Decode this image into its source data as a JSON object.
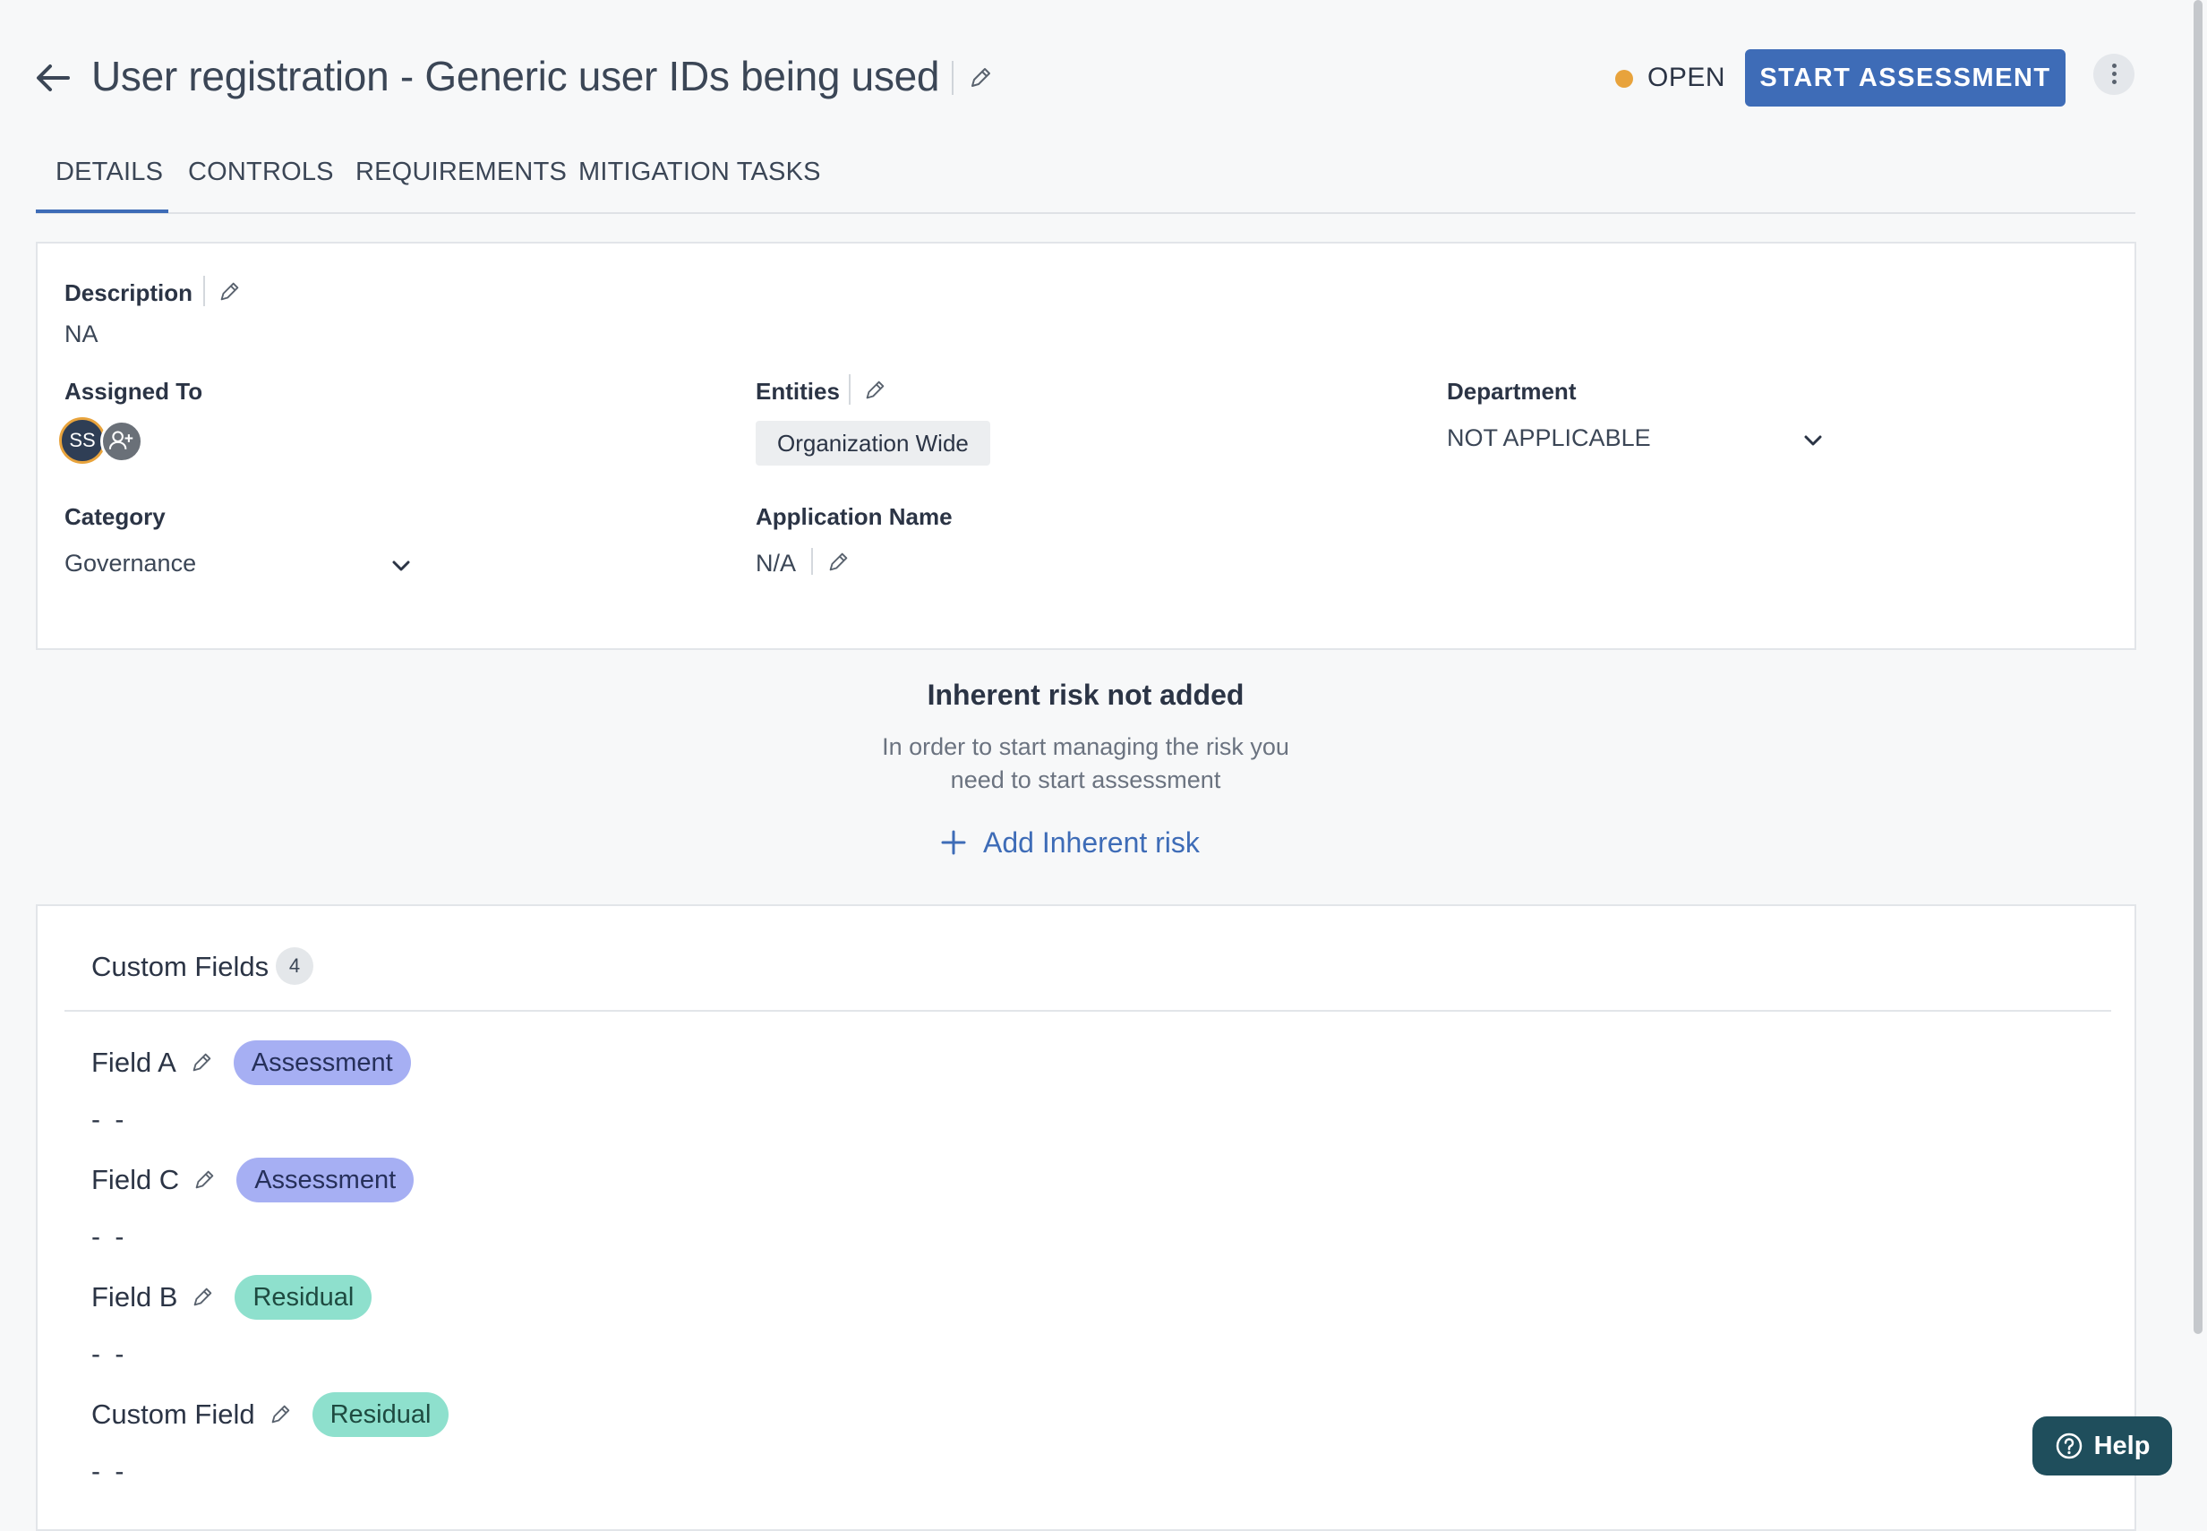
{
  "header": {
    "title": "User registration - Generic user IDs being used",
    "status": "OPEN",
    "start_button": "START ASSESSMENT"
  },
  "tabs": [
    {
      "label": "DETAILS",
      "active": true
    },
    {
      "label": "CONTROLS",
      "active": false
    },
    {
      "label": "REQUIREMENTS",
      "active": false
    },
    {
      "label": "MITIGATION TASKS",
      "active": false
    }
  ],
  "details": {
    "description_label": "Description",
    "description_value": "NA",
    "assigned_label": "Assigned To",
    "assignee_initials": "SS",
    "entities_label": "Entities",
    "entity_chip": "Organization Wide",
    "department_label": "Department",
    "department_value": "NOT APPLICABLE",
    "category_label": "Category",
    "category_value": "Governance",
    "app_name_label": "Application Name",
    "app_name_value": "N/A"
  },
  "inherent": {
    "title": "Inherent risk not added",
    "desc_line1": "In order to start managing the risk you",
    "desc_line2": "need to start assessment",
    "add_label": "Add Inherent risk"
  },
  "custom_fields": {
    "title": "Custom Fields",
    "count": "4",
    "fields": [
      {
        "name": "Field A",
        "badge": "Assessment",
        "value": "- -"
      },
      {
        "name": "Field C",
        "badge": "Assessment",
        "value": "- -"
      },
      {
        "name": "Field B",
        "badge": "Residual",
        "value": "- -"
      },
      {
        "name": "Custom Field",
        "badge": "Residual",
        "value": "- -"
      }
    ]
  },
  "help_label": "Help",
  "colors": {
    "accent": "#3e6cb7",
    "status_open": "#e8a33c",
    "badge_assessment": "#a6aff3",
    "badge_residual": "#8ee0cd",
    "help_bg": "#1f4e5c"
  },
  "icons": [
    "back-arrow-icon",
    "pencil-icon",
    "more-vertical-icon",
    "chevron-down-icon",
    "add-user-icon",
    "plus-icon",
    "help-circle-icon"
  ]
}
